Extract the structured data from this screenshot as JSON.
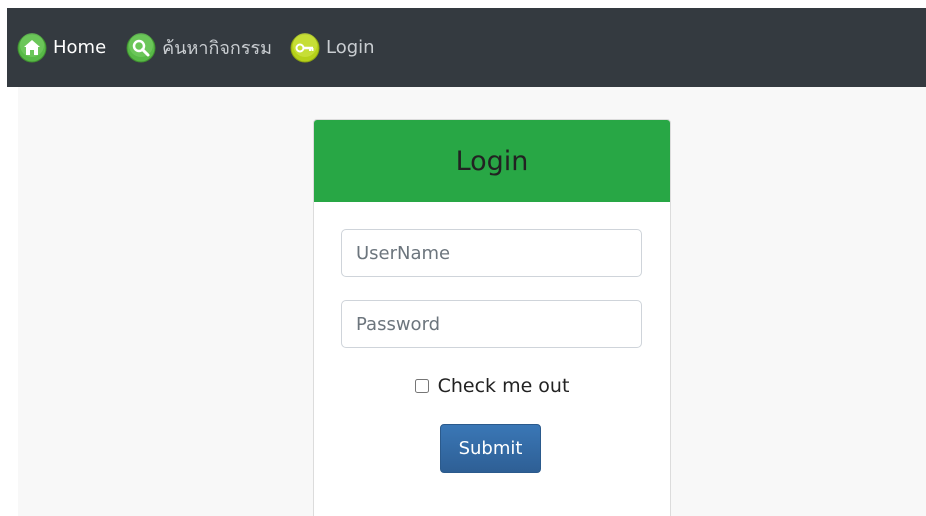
{
  "navbar": {
    "items": [
      {
        "label": "Home",
        "icon": "home-icon",
        "icon_color": "#4caf50"
      },
      {
        "label": "ค้นหากิจกรรม",
        "icon": "search-icon",
        "icon_color": "#4caf50"
      },
      {
        "label": "Login",
        "icon": "key-icon",
        "icon_color": "#b6d11a"
      }
    ],
    "background": "#343a40"
  },
  "login_card": {
    "title": "Login",
    "header_color": "#28a745",
    "username_placeholder": "UserName",
    "password_placeholder": "Password",
    "checkbox_label": "Check me out",
    "submit_label": "Submit",
    "submit_color": "#2e6aa5"
  }
}
